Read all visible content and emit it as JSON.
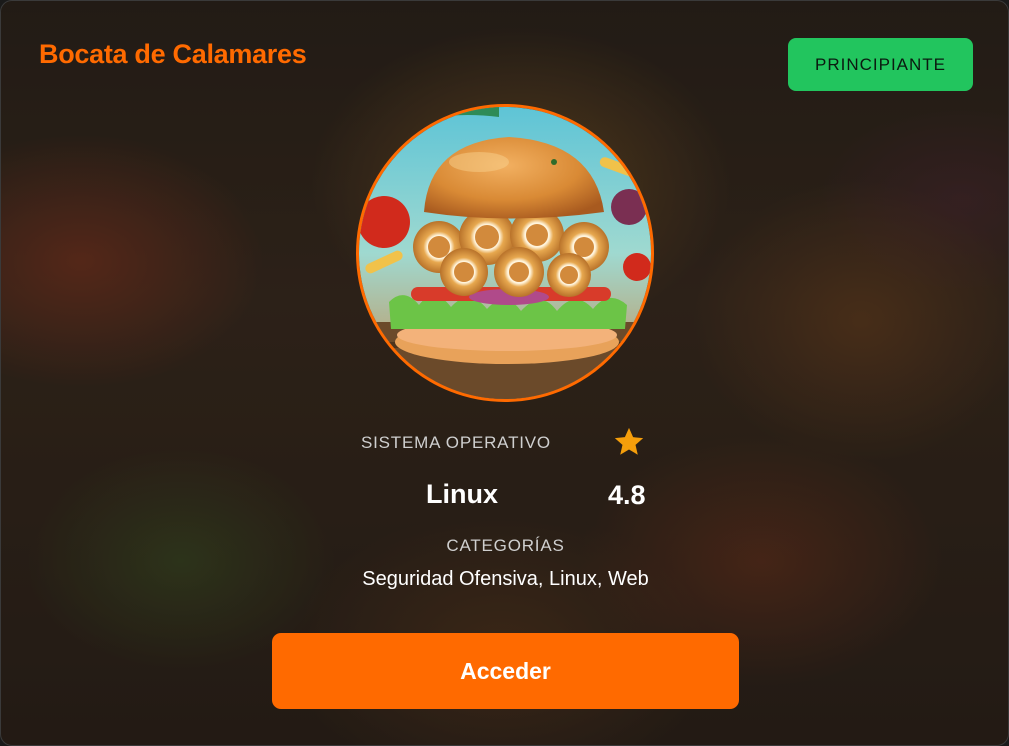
{
  "card": {
    "title": "Bocata de Calamares",
    "difficulty_badge": "PRINCIPIANTE",
    "image_subject": "calamari-sandwich-image"
  },
  "details": {
    "os_label": "SISTEMA OPERATIVO",
    "os_value": "Linux",
    "rating": "4.8",
    "rating_icon": "star-icon",
    "categories_label": "CATEGORÍAS",
    "categories_value": "Seguridad Ofensiva, Linux, Web"
  },
  "actions": {
    "access_label": "Acceder"
  },
  "colors": {
    "accent": "#ff6a00",
    "badge": "#22c55e",
    "star": "#f59e0b"
  }
}
